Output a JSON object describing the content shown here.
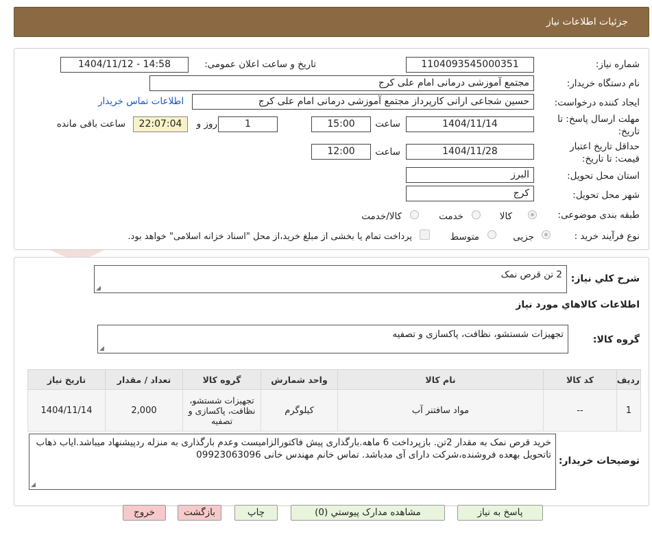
{
  "header": {
    "title": "جزئيات اطلاعات نیاز"
  },
  "watermark": {
    "text": "AriaTender.neT"
  },
  "details": {
    "need_number_label": "شماره نیاز:",
    "need_number": "1104093545000351",
    "announce_label": "تاریخ و ساعت اعلان عمومی:",
    "announce_value": "1404/11/12 - 14:58",
    "buyer_org_label": "نام دستگاه خریدار:",
    "buyer_org": "مجتمع آموزشی درمانی امام علی کرج",
    "requester_label": "ایجاد کننده درخواست:",
    "requester": "حسین شجاعی ارانی کارپرداز مجتمع آموزشی درمانی امام علی کرج",
    "contact_link": "اطلاعات تماس خریدار",
    "deadline_label_1": "مهلت ارسال پاسخ: تا",
    "deadline_label_2": "تاریخ:",
    "deadline_date": "1404/11/14",
    "time_label": "ساعت",
    "deadline_time": "15:00",
    "days_value": "1",
    "days_label": "روز و",
    "remaining_time": "22:07:04",
    "remaining_label": "ساعت باقی مانده",
    "validity_label_1": "حداقل تاریخ اعتبار",
    "validity_label_2": "قیمت: تا تاریخ:",
    "validity_date": "1404/11/28",
    "validity_time": "12:00",
    "province_label": "استان محل تحویل:",
    "province": "البرز",
    "city_label": "شهر محل تحویل:",
    "city": "کرج",
    "category_label": "طبقه بندی موضوعی:",
    "category_options": [
      "کالا",
      "خدمت",
      "کالا/خدمت"
    ],
    "process_label": "نوع فرآیند خرید :",
    "process_options": [
      "جزیی",
      "متوسط"
    ],
    "payment_note": "پرداخت تمام یا بخشی از مبلغ خرید،از محل \"اسناد خزانه اسلامی\" خواهد بود."
  },
  "summary": {
    "general_label": "شرح کلي نياز:",
    "general_value": "2 تن قرص نمک",
    "goods_info_title": "اطلاعات کالاهاي مورد نياز",
    "group_label": "گروه کالا:",
    "group_value": "تجهیزات شستشو، نظافت، پاکسازی و تصفیه",
    "table": {
      "headers": [
        "ردیف",
        "کد کالا",
        "نام کالا",
        "واحد شمارش",
        "گروه کالا",
        "تعداد / مقدار",
        "تاریخ نیاز"
      ],
      "rows": [
        [
          "1",
          "--",
          "مواد سافتنر آب",
          "کیلوگرم",
          "تجهیزات شستشو، نظافت، پاکسازی و تصفیه",
          "2,000",
          "1404/11/14"
        ]
      ]
    },
    "buyer_notes_label": "توضیحات خریدار:",
    "buyer_notes": "خرید قرص نمک به مقدار 2تن. بازپرداخت 6 ماهه.بارگذاری پیش فاکتورالزامیست وعدم بارگذاری به منزله ردپیشنهاد میباشد.ایاب ذهاب تاتحویل بهعده فروشنده،شرکت دارای آی مدباشد. تماس خانم مهندس خانی 09923063096"
  },
  "buttons": {
    "reply": "پاسخ به نیاز",
    "attachments": "مشاهده مدارک پیوستي (0)",
    "print": "چاپ",
    "back": "بازگشت",
    "exit": "خروج"
  },
  "colors": {
    "header_bg": "#8b6a43",
    "link": "#1a55c9",
    "highlight_bg": "#f7f2c8",
    "button_green": "#e8f5dc",
    "button_red": "#f7c9c9"
  }
}
